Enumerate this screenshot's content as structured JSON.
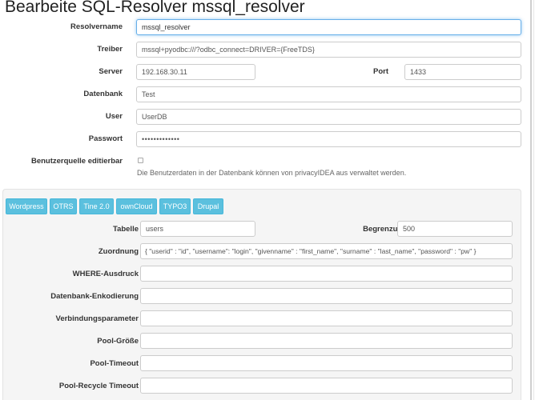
{
  "page": {
    "title": "Bearbeite SQL-Resolver mssql_resolver"
  },
  "form": {
    "resolvername": {
      "label": "Resolvername",
      "value": "mssql_resolver"
    },
    "treiber": {
      "label": "Treiber",
      "value": "mssql+pyodbc:///?odbc_connect=DRIVER={FreeTDS}"
    },
    "server": {
      "label": "Server",
      "value": "192.168.30.11"
    },
    "port": {
      "label": "Port",
      "value": "1433"
    },
    "datenbank": {
      "label": "Datenbank",
      "value": "Test"
    },
    "user": {
      "label": "User",
      "value": "UserDB"
    },
    "passwort": {
      "label": "Passwort",
      "value": "•••••••••••••"
    },
    "editable": {
      "label": "Benutzerquelle editierbar",
      "checked": false,
      "help": "Die Benutzerdaten in der Datenbank können von privacyIDEA aus verwaltet werden."
    }
  },
  "presets": {
    "buttons": [
      "Wordpress",
      "OTRS",
      "Tine 2.0",
      "ownCloud",
      "TYPO3",
      "Drupal"
    ],
    "color": "#5bc0de"
  },
  "mapping": {
    "tabelle": {
      "label": "Tabelle",
      "value": "users"
    },
    "begrenzung": {
      "label": "Begrenzung",
      "value": "500"
    },
    "zuordnung": {
      "label": "Zuordnung",
      "value": "{ \"userid\" : \"id\", \"username\": \"login\", \"givenname\" : \"first_name\", \"surname\" : \"last_name\", \"password\" : \"pw\" }"
    },
    "where": {
      "label": "WHERE-Ausdruck",
      "value": ""
    },
    "encoding": {
      "label": "Datenbank-Enkodierung",
      "value": ""
    },
    "conn_params": {
      "label": "Verbindungsparameter",
      "value": ""
    },
    "pool_size": {
      "label": "Pool-Größe",
      "value": ""
    },
    "pool_timeout": {
      "label": "Pool-Timeout",
      "value": ""
    },
    "pool_recycle": {
      "label": "Pool-Recycle Timeout",
      "value": ""
    }
  }
}
